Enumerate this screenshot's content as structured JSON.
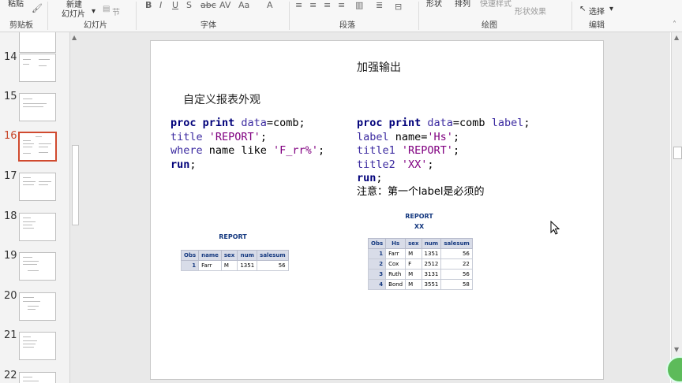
{
  "ribbon": {
    "clipboard": {
      "paste_label": "粘贴",
      "group_label": "剪贴板"
    },
    "slides": {
      "new_slide_line1": "新建",
      "new_slide_line2": "幻灯片",
      "section_label": "节",
      "group_label": "幻灯片"
    },
    "font": {
      "group_label": "字体"
    },
    "paragraph": {
      "group_label": "段落"
    },
    "drawing": {
      "shape_label": "形状",
      "arrange_label": "排列",
      "quick_styles_label": "快速样式",
      "shape_effects_label": "形状效果",
      "group_label": "绘图"
    },
    "editing": {
      "select_label": "选择",
      "group_label": "编辑"
    }
  },
  "thumbnails": [
    {
      "num": "14",
      "active": false
    },
    {
      "num": "15",
      "active": false
    },
    {
      "num": "16",
      "active": true
    },
    {
      "num": "17",
      "active": false
    },
    {
      "num": "18",
      "active": false
    },
    {
      "num": "19",
      "active": false
    },
    {
      "num": "20",
      "active": false
    },
    {
      "num": "21",
      "active": false
    },
    {
      "num": "22",
      "active": false
    }
  ],
  "slide": {
    "title": "加强输出",
    "subtitle": "自定义报表外观",
    "left_code": {
      "l1_kw": "proc print",
      "l1_a": " data",
      "l1_b": "=comb;",
      "l2_a": "title ",
      "l2_b": "'REPORT'",
      "l2_c": ";",
      "l3_a": "where",
      "l3_b": " name like ",
      "l3_c": "'F_rr%'",
      "l3_d": ";",
      "l4_kw": "run",
      "l4_b": ";"
    },
    "right_code": {
      "l1_kw": "proc print",
      "l1_a": " data",
      "l1_b": "=comb ",
      "l1_c": "label",
      "l1_d": ";",
      "l2_a": "label",
      "l2_b": " name=",
      "l2_c": "'Hs'",
      "l2_d": ";",
      "l3_a": "title1 ",
      "l3_b": "'REPORT'",
      "l3_c": ";",
      "l4_a": "title2 ",
      "l4_b": "'XX'",
      "l4_c": ";",
      "l5_kw": "run",
      "l5_b": ";"
    },
    "note": "注意：第一个label是必须的",
    "report1": {
      "title": "REPORT",
      "headers": [
        "Obs",
        "name",
        "sex",
        "num",
        "salesum"
      ],
      "rows": [
        [
          "1",
          "Farr",
          "M",
          "1351",
          "56"
        ]
      ]
    },
    "report2": {
      "title1": "REPORT",
      "title2": "XX",
      "headers": [
        "Obs",
        "Hs",
        "sex",
        "num",
        "salesum"
      ],
      "rows": [
        [
          "1",
          "Farr",
          "M",
          "1351",
          "56"
        ],
        [
          "2",
          "Cox",
          "F",
          "2512",
          "22"
        ],
        [
          "3",
          "Ruth",
          "M",
          "3131",
          "56"
        ],
        [
          "4",
          "Bond",
          "M",
          "3551",
          "58"
        ]
      ]
    }
  }
}
